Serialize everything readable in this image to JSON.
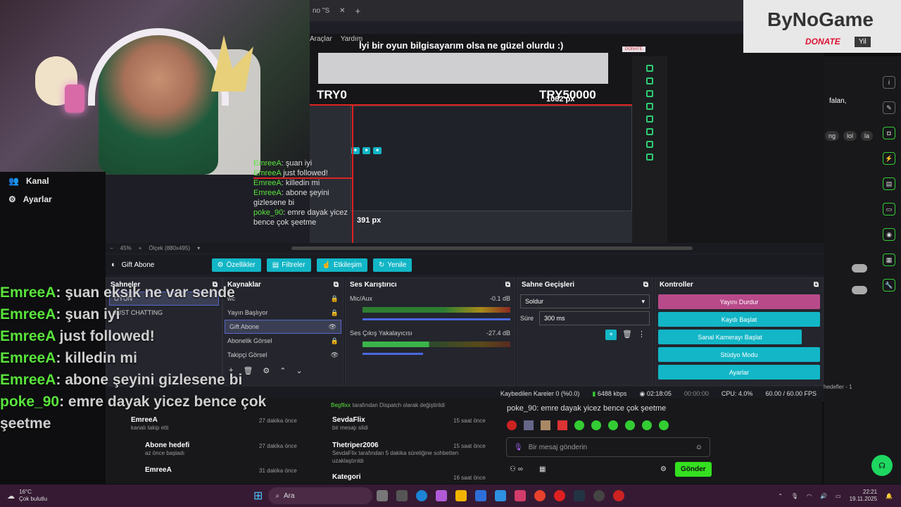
{
  "browser_tab": {
    "title": "no \"S",
    "close": "✕",
    "new": "+"
  },
  "obs_menu": [
    "Araçlar",
    "Yardım"
  ],
  "headline": "İyi bir oyun bilgisayarım olsa ne güzel olurdu :)",
  "preview": {
    "try0": "TRY0",
    "try_max": "TRY50000",
    "px_h": "1062 px",
    "px_v": "391 px",
    "donate_tag": "DONATE"
  },
  "nav": [
    {
      "icon": "people-icon",
      "label": "Kanal"
    },
    {
      "icon": "gear-icon",
      "label": "Ayarlar"
    }
  ],
  "zoom": {
    "percent": "45%",
    "scale": "Ölçek (880x495)"
  },
  "source_bar": {
    "name": "Gift Abone",
    "buttons": [
      "Özellikler",
      "Filtreler",
      "Etkileşim",
      "Yenile"
    ]
  },
  "scenes": {
    "title": "Sahneler",
    "items": [
      "OYUN",
      "JUST CHATTING"
    ]
  },
  "sources": {
    "title": "Kaynaklar",
    "items": [
      "wc",
      "Yayın Başlıyor",
      "Gift Abone",
      "Abonelik Görsel",
      "Takipçi Görsel"
    ]
  },
  "mixer": {
    "title": "Ses Karıştırıcı",
    "channels": [
      {
        "name": "Mic/Aux",
        "db": "-0.1 dB"
      },
      {
        "name": "Ses Çıkış Yakalayıcısı",
        "db": "-27.4 dB"
      }
    ],
    "scale": [
      "-60",
      "-55",
      "-50",
      "-45",
      "-40",
      "-35",
      "-30",
      "-25",
      "-20",
      "-15",
      "-10",
      "-5",
      "0"
    ]
  },
  "transitions": {
    "title": "Sahne Geçişleri",
    "type": "Soldur",
    "duration_label": "Süre",
    "duration": "300 ms"
  },
  "controls": {
    "title": "Kontroller",
    "stop": "Yayını Durdur",
    "record": "Kaydı Başlat",
    "vcam": "Sanal Kamerayı Başlat",
    "studio": "Stüdyo Modu",
    "settings": "Ayarlar"
  },
  "status": {
    "dropped": "Kaybedilen Kareler 0 (%0.0)",
    "kbps": "6488 kbps",
    "live": "02:18:05",
    "rec": "00:00:00",
    "cpu": "CPU: 4.0%",
    "fps": "60.00 / 60.00 FPS"
  },
  "chat_overlay": [
    {
      "name": "EmreeA",
      "msg": ": şuan eksik ne var sende"
    },
    {
      "name": "EmreeA",
      "msg": ": şuan iyi"
    },
    {
      "name": "EmreeA",
      "msg": " just followed!"
    },
    {
      "name": "EmreeA",
      "msg": ": killedin mi"
    },
    {
      "name": "EmreeA",
      "msg": ": abone şeyini gizlesene bi"
    },
    {
      "name": "poke_90",
      "msg": ": emre dayak yicez bence çok şeetme"
    }
  ],
  "small_chat": [
    {
      "name": "EmreeA",
      "msg": ": şuan iyi"
    },
    {
      "name": "EmreeA",
      "msg": " just followed!"
    },
    {
      "name": "EmreeA",
      "msg": ": killedin mi"
    },
    {
      "name": "EmreeA",
      "msg": ": abone şeyini gizlesene bi"
    },
    {
      "name": "poke_90",
      "msg": ": emre dayak yicez bence çok şeetme"
    }
  ],
  "feed_left": [
    {
      "title": "EmreeA",
      "sub": "kanalı takip etti",
      "time": "27 dakika önce"
    },
    {
      "title": "Abone hedefi",
      "sub": "az önce başladı",
      "time": "27 dakika önce"
    },
    {
      "title": "EmreeA",
      "sub": "",
      "time": "31 dakika önce"
    }
  ],
  "feed_mid": [
    {
      "title": "Begflixx",
      "sub": "tarafından Dispatch olarak değiştirildi",
      "time": ""
    },
    {
      "title": "SevdaFlix",
      "sub": "bir mesajı sildi",
      "time": "15 saat önce"
    },
    {
      "title": "Thetriper2006",
      "sub": "SevdaFlix tarafından 5 dakika süreliğine sohbetten uzaklaştırıldı",
      "time": "15 saat önce"
    },
    {
      "title": "Kategori",
      "sub": "",
      "time": "16 saat önce"
    }
  ],
  "stream_chat": {
    "last_line": "poke_90: emre dayak yicez bence çok şeetme",
    "placeholder": "Bir mesaj gönderin",
    "send": "Gönder"
  },
  "right_side": {
    "chat_snip": "falan,",
    "chips": [
      "ng",
      "lol",
      "la"
    ],
    "goal": "hedefler - 1"
  },
  "bynogame": {
    "logo": "ByNoGame",
    "donate": "DONATE",
    "small": "Yil"
  },
  "taskbar": {
    "temp": "16°C",
    "weather": "Çok bulutlu",
    "search": "Ara",
    "time": "22:21",
    "date": "19.11.2025"
  }
}
